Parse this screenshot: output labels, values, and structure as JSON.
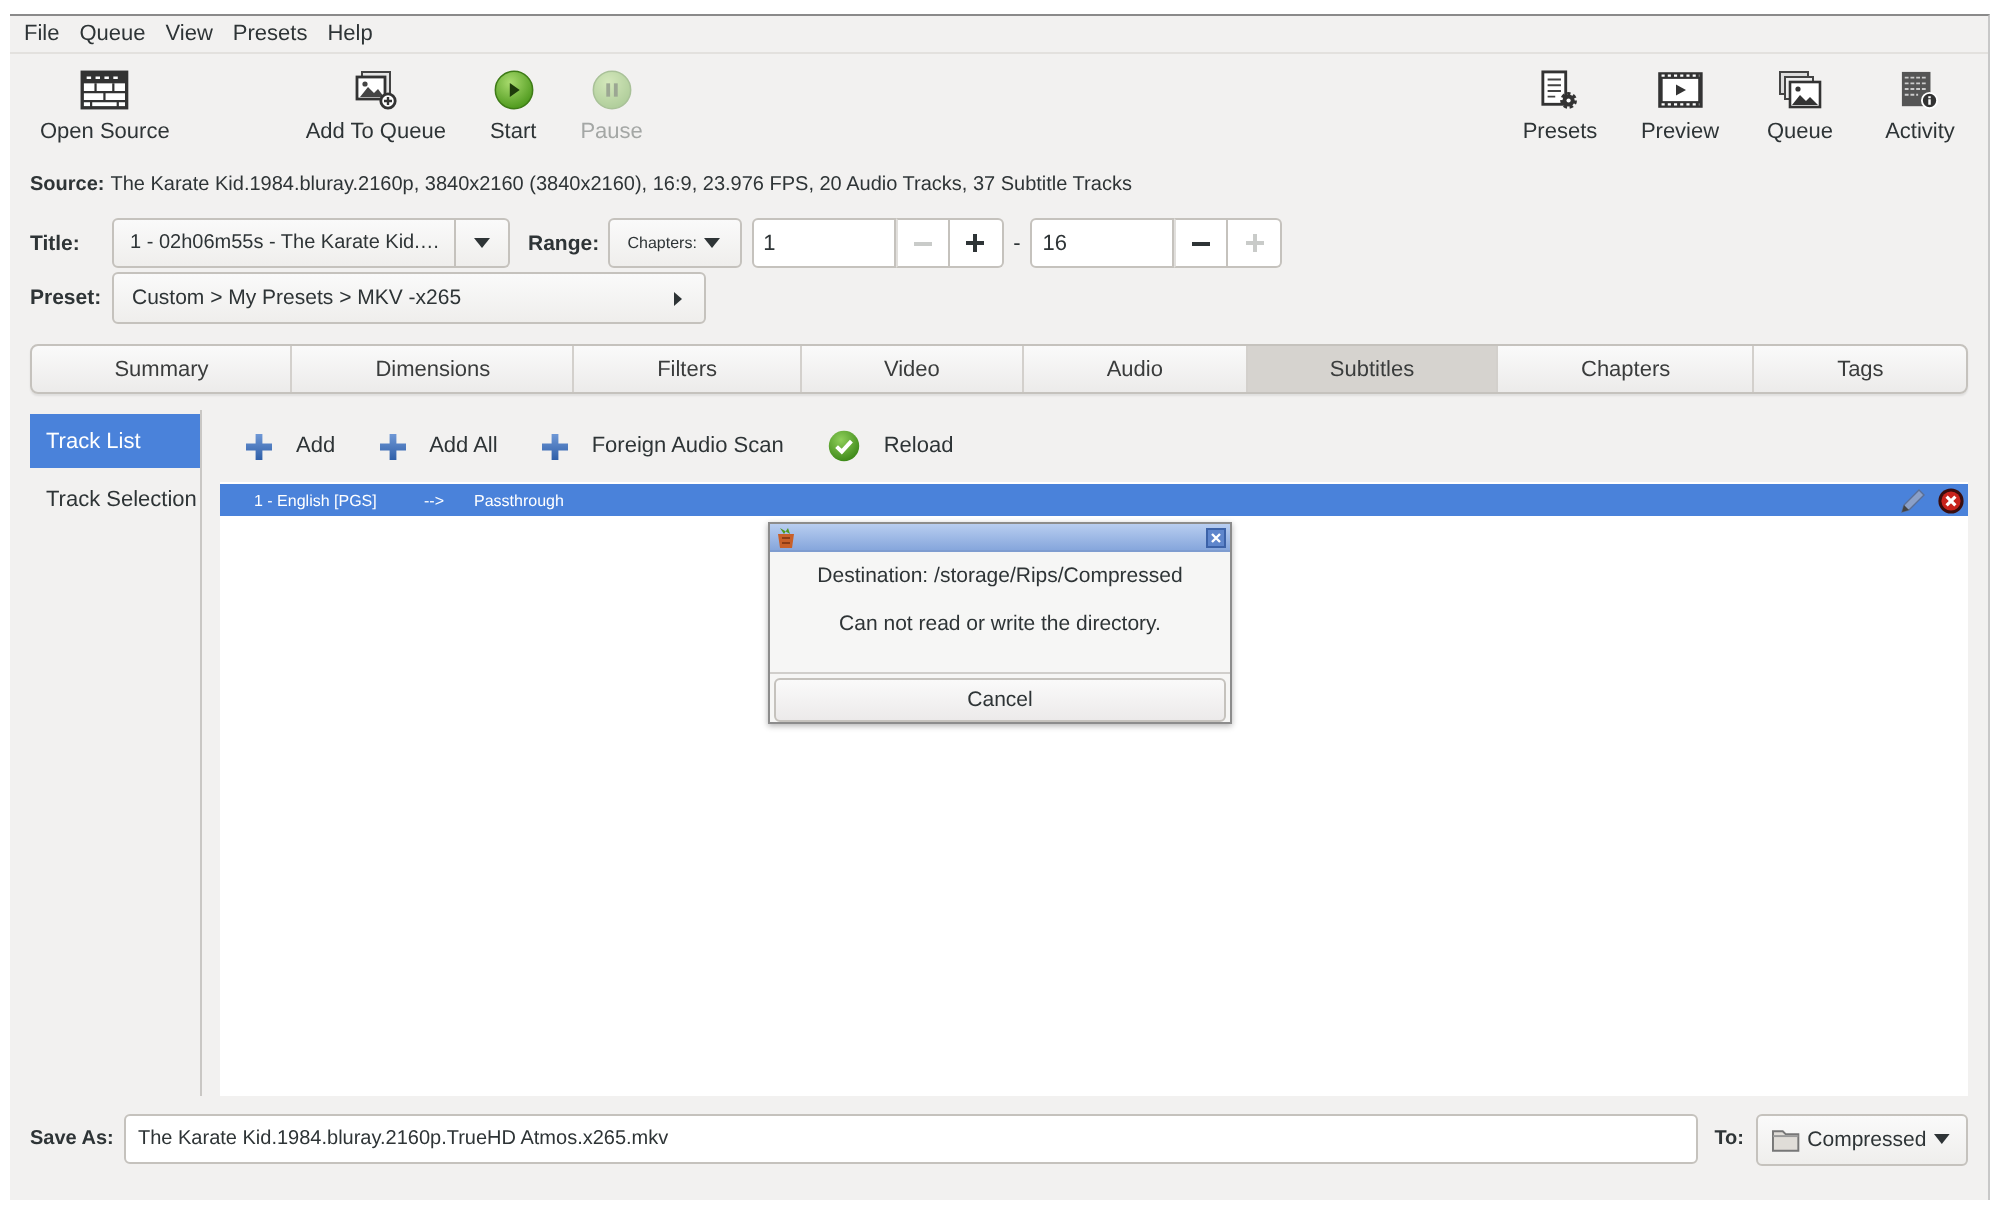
{
  "menu": [
    "File",
    "Queue",
    "View",
    "Presets",
    "Help"
  ],
  "toolbar": {
    "left": [
      {
        "label": "Open Source",
        "kind": "source",
        "disabled": false
      },
      {
        "label": "Add To Queue",
        "kind": "enqueue",
        "disabled": false
      },
      {
        "label": "Start",
        "kind": "start",
        "disabled": false
      },
      {
        "label": "Pause",
        "kind": "pause",
        "disabled": true
      }
    ],
    "right": [
      {
        "label": "Presets",
        "kind": "presets",
        "disabled": false
      },
      {
        "label": "Preview",
        "kind": "preview",
        "disabled": false
      },
      {
        "label": "Queue",
        "kind": "queue",
        "disabled": false
      },
      {
        "label": "Activity",
        "kind": "activity",
        "disabled": false
      }
    ]
  },
  "source": {
    "label": "Source:",
    "text": "The Karate Kid.1984.bluray.2160p, 3840x2160 (3840x2160), 16:9, 23.976 FPS, 20 Audio Tracks, 37 Subtitle Tracks"
  },
  "title": {
    "label": "Title:",
    "value": "1 - 02h06m55s - The Karate Kid.…"
  },
  "range": {
    "label": "Range:",
    "mode": "Chapters:",
    "start": {
      "value": "1",
      "decrement_disabled": true,
      "increment_disabled": false
    },
    "separator": "-",
    "end": {
      "value": "16",
      "decrement_disabled": false,
      "increment_disabled": true
    }
  },
  "preset": {
    "label": "Preset:",
    "value": "Custom > My Presets > MKV -x265"
  },
  "tabs": [
    {
      "label": "Summary",
      "selected": false
    },
    {
      "label": "Dimensions",
      "selected": false
    },
    {
      "label": "Filters",
      "selected": false
    },
    {
      "label": "Video",
      "selected": false
    },
    {
      "label": "Audio",
      "selected": false
    },
    {
      "label": "Subtitles",
      "selected": true
    },
    {
      "label": "Chapters",
      "selected": false
    },
    {
      "label": "Tags",
      "selected": false
    }
  ],
  "sidebar": [
    {
      "label": "Track List",
      "selected": true
    },
    {
      "label": "Track Selection",
      "selected": false
    }
  ],
  "track_actions": [
    {
      "label": "Add",
      "kind": "add"
    },
    {
      "label": "Add All",
      "kind": "add"
    },
    {
      "label": "Foreign Audio Scan",
      "kind": "add"
    },
    {
      "label": "Reload",
      "kind": "reload"
    }
  ],
  "tracks": [
    {
      "source": "1 - English [PGS]",
      "arrow": "-->",
      "output": "Passthrough",
      "selected": true
    }
  ],
  "dialog": {
    "messages": [
      "Destination: /storage/Rips/Compressed",
      "Can not read or write the directory."
    ],
    "button": "Cancel"
  },
  "save": {
    "label": "Save As:",
    "value": "The Karate Kid.1984.bluray.2160p.TrueHD Atmos.x265.mkv",
    "to_label": "To:",
    "folder": "Compressed"
  }
}
